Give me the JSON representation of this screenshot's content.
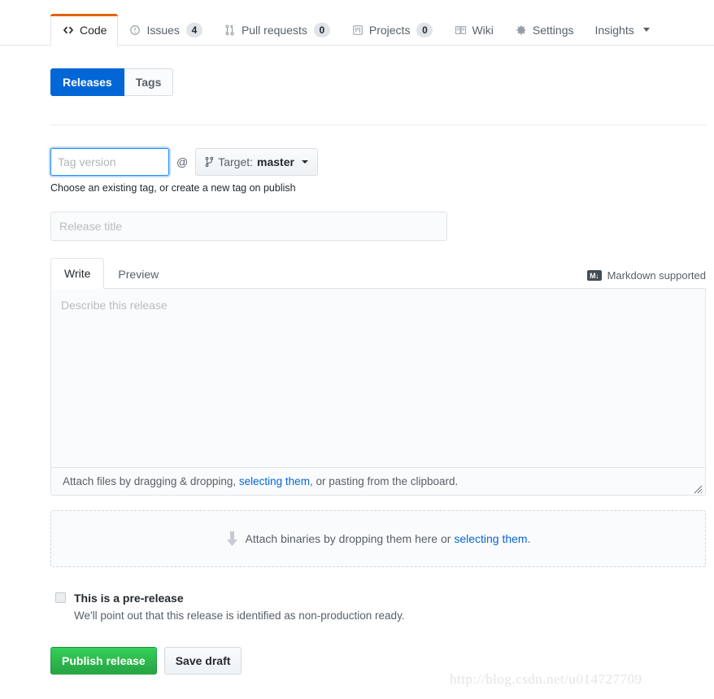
{
  "repo_nav": {
    "items": [
      {
        "label": "Code",
        "icon": "code-icon",
        "count": null,
        "selected": true,
        "dropdown": false
      },
      {
        "label": "Issues",
        "icon": "issue-opened-icon",
        "count": "4",
        "selected": false,
        "dropdown": false
      },
      {
        "label": "Pull requests",
        "icon": "git-pull-request-icon",
        "count": "0",
        "selected": false,
        "dropdown": false
      },
      {
        "label": "Projects",
        "icon": "project-icon",
        "count": "0",
        "selected": false,
        "dropdown": false
      },
      {
        "label": "Wiki",
        "icon": "book-icon",
        "count": null,
        "selected": false,
        "dropdown": false
      },
      {
        "label": "Settings",
        "icon": "gear-icon",
        "count": null,
        "selected": false,
        "dropdown": false
      },
      {
        "label": "Insights",
        "icon": null,
        "count": null,
        "selected": false,
        "dropdown": true
      }
    ],
    "selected_accent": "#e36209"
  },
  "segmented": {
    "releases_label": "Releases",
    "tags_label": "Tags",
    "active": "Releases",
    "active_color": "#0366d6"
  },
  "tag_field": {
    "placeholder": "Tag version",
    "value": "",
    "at_symbol": "@",
    "focus_color": "#2188ff",
    "target": {
      "prefix": "Target:",
      "branch": "master",
      "icon": "git-branch-icon"
    },
    "hint": "Choose an existing tag, or create a new tag on publish"
  },
  "release_title": {
    "placeholder": "Release title",
    "value": ""
  },
  "editor": {
    "tabs": [
      {
        "label": "Write",
        "selected": true
      },
      {
        "label": "Preview",
        "selected": false
      }
    ],
    "markdown_note": "Markdown supported",
    "markdown_icon_text": "M↓",
    "body_placeholder": "Describe this release",
    "body_value": "",
    "footer": {
      "before": "Attach files by dragging & dropping, ",
      "link": "selecting them",
      "after": ", or pasting from the clipboard."
    }
  },
  "dropzone": {
    "icon": "download-arrow-icon",
    "before": "Attach binaries by dropping them here or ",
    "link": "selecting them",
    "after": "."
  },
  "prerelease": {
    "checked": false,
    "title": "This is a pre-release",
    "subtitle": "We'll point out that this release is identified as non-production ready."
  },
  "actions": {
    "publish_label": "Publish release",
    "publish_color": "#2cbe4e",
    "save_draft_label": "Save draft"
  },
  "watermark": {
    "text": "http://blog.csdn.net/u014727709"
  },
  "link_color": "#0366d6"
}
